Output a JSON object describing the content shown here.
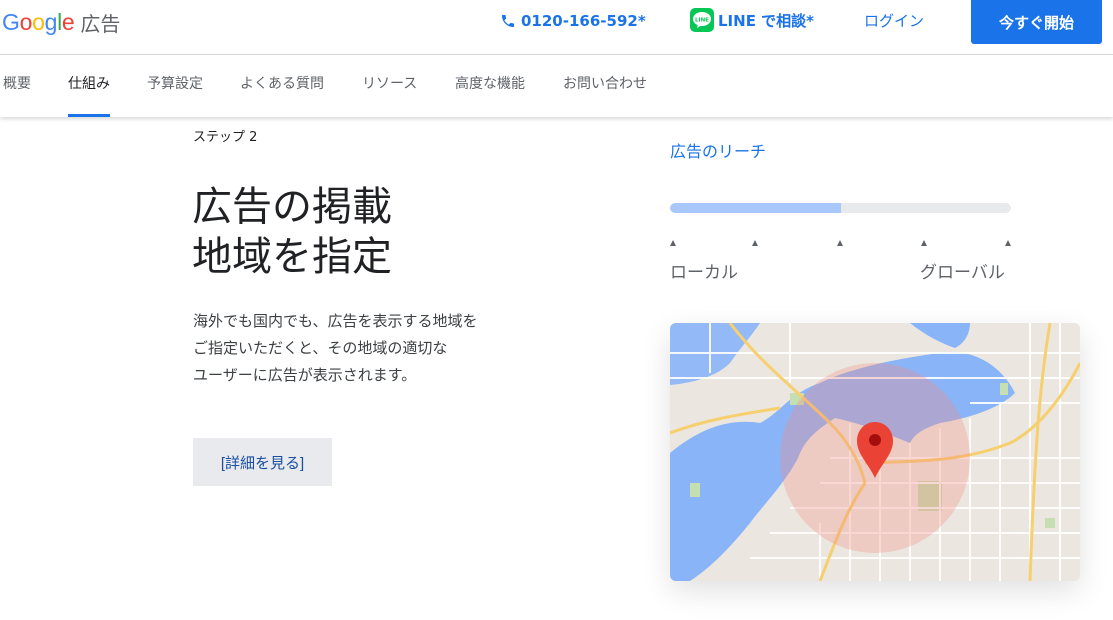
{
  "header": {
    "logo_text": "Google",
    "logo_suffix": "広告",
    "phone": "0120-166-592*",
    "line_text": "LINE で相談*",
    "line_icon_text": "LINE",
    "login": "ログイン",
    "cta": "今すぐ開始"
  },
  "nav": {
    "items": [
      {
        "label": "概要",
        "active": false
      },
      {
        "label": "仕組み",
        "active": true
      },
      {
        "label": "予算設定",
        "active": false
      },
      {
        "label": "よくある質問",
        "active": false
      },
      {
        "label": "リソース",
        "active": false
      },
      {
        "label": "高度な機能",
        "active": false
      },
      {
        "label": "お問い合わせ",
        "active": false
      }
    ]
  },
  "main": {
    "step": "ステップ 2",
    "title_line1": "広告の掲載",
    "title_line2": "地域を指定",
    "desc_line1": "海外でも国内でも、広告を表示する地域を",
    "desc_line2": "ご指定いただくと、その地域の適切な",
    "desc_line3": "ユーザーに広告が表示されます。",
    "detail_button": "[詳細を見る]"
  },
  "reach": {
    "label": "広告のリーチ",
    "level": 0.5,
    "local_label": "ローカル",
    "global_label": "グローバル"
  },
  "colors": {
    "accent": "#1a73e8",
    "line_green": "#06c755",
    "pin_red": "#ea4335"
  },
  "icons": [
    "phone-icon",
    "line-icon",
    "map-pin-icon"
  ]
}
